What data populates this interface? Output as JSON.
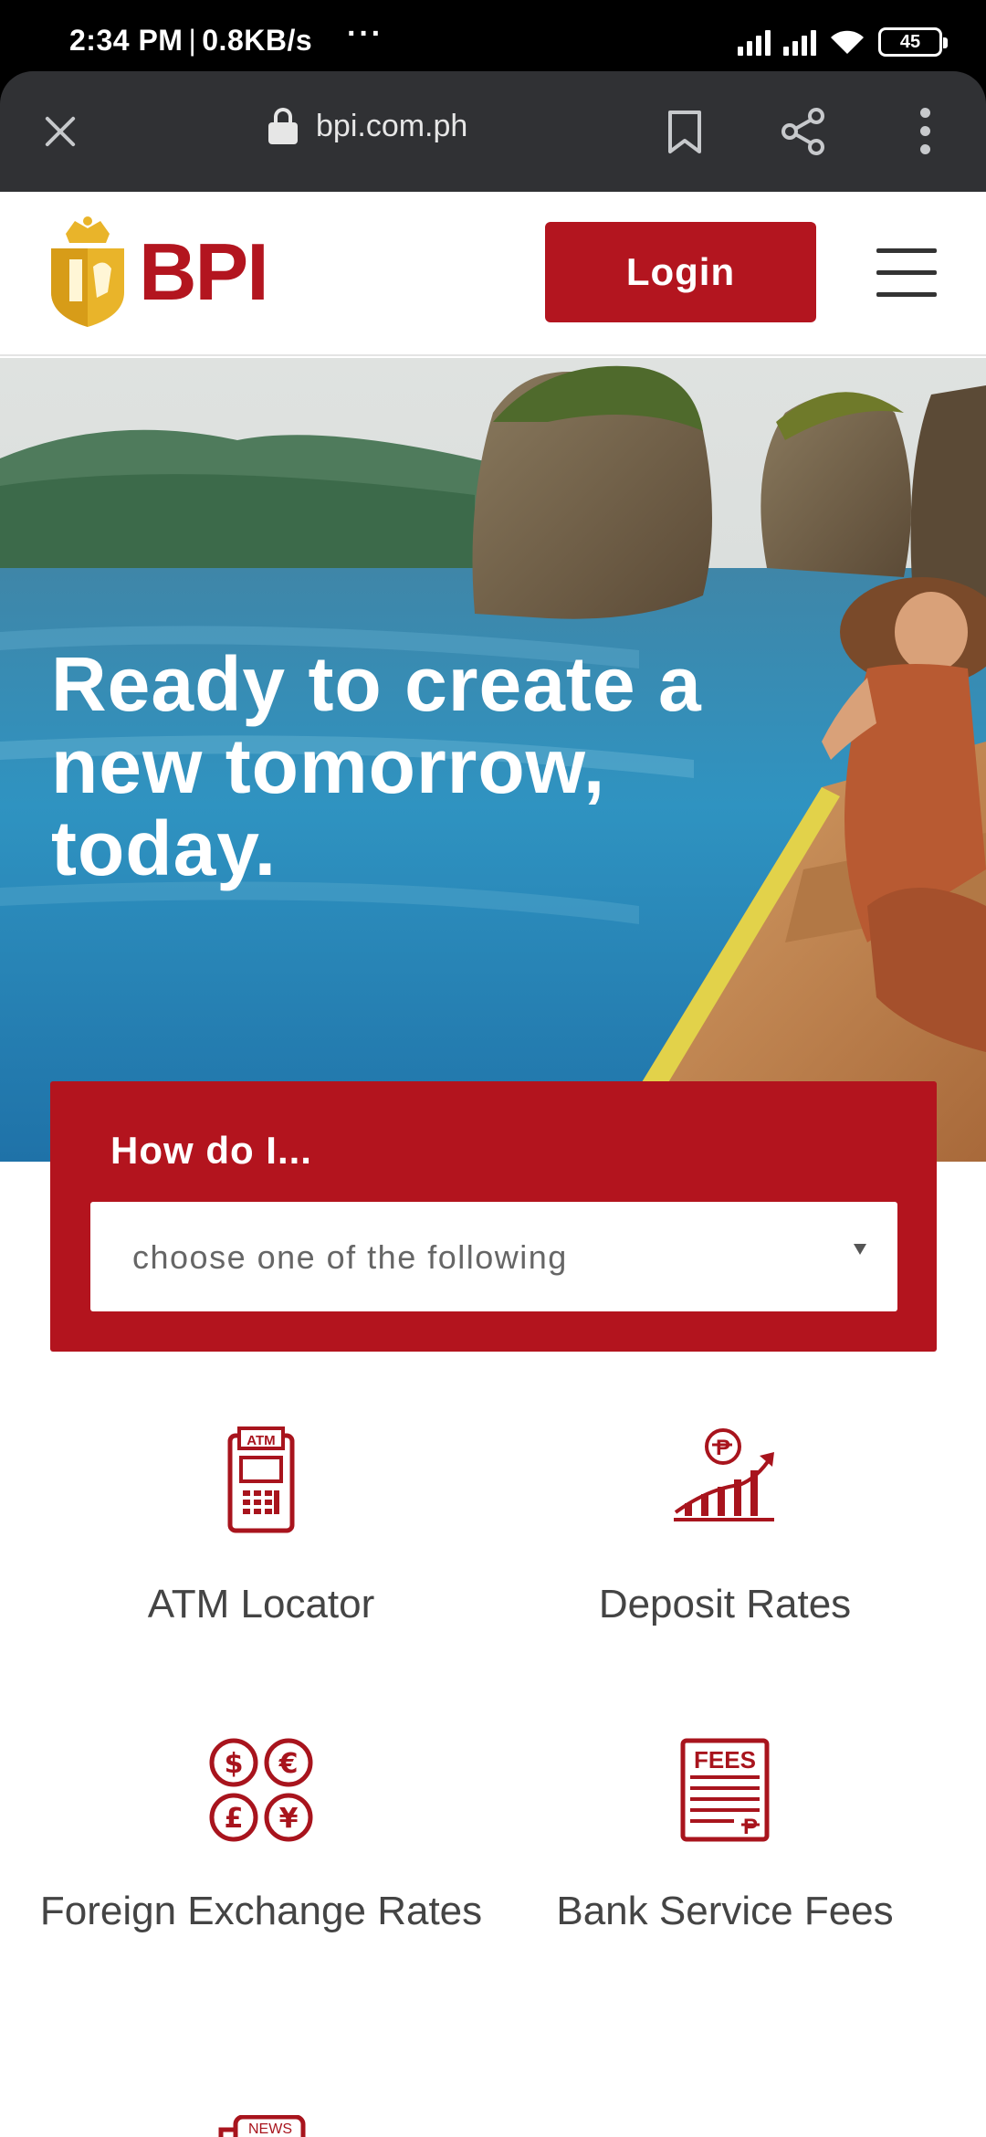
{
  "status_bar": {
    "time": "2:34 PM",
    "speed": "0.8KB/s",
    "dots": "···",
    "battery": "45",
    "icons": [
      "signal-icon",
      "signal-icon",
      "wifi-icon",
      "battery-icon"
    ]
  },
  "browser": {
    "url": "bpi.com.ph",
    "icons": [
      "close-icon",
      "lock-icon",
      "bookmark-icon",
      "share-icon",
      "more-vert-icon"
    ]
  },
  "header": {
    "logo_text": "BPI",
    "login_label": "Login",
    "menu_icon": "hamburger-menu-icon"
  },
  "hero": {
    "headline": "Ready to create a new tomorrow, today."
  },
  "how_do_i": {
    "label": "How do I...",
    "placeholder": "choose one of the following"
  },
  "quick_links": [
    {
      "label": "ATM Locator",
      "icon": "atm-icon"
    },
    {
      "label": "Deposit Rates",
      "icon": "deposit-rates-icon"
    },
    {
      "label": "Foreign Exchange Rates",
      "icon": "currency-icon"
    },
    {
      "label": "Bank Service Fees",
      "icon": "fees-icon"
    },
    {
      "label": "",
      "icon": "news-icon",
      "badge": "NEWS"
    }
  ],
  "colors": {
    "brand_red": "#b3151f",
    "brand_gold": "#e9b42a",
    "status_bg": "#000000",
    "browser_bg": "#303134"
  }
}
